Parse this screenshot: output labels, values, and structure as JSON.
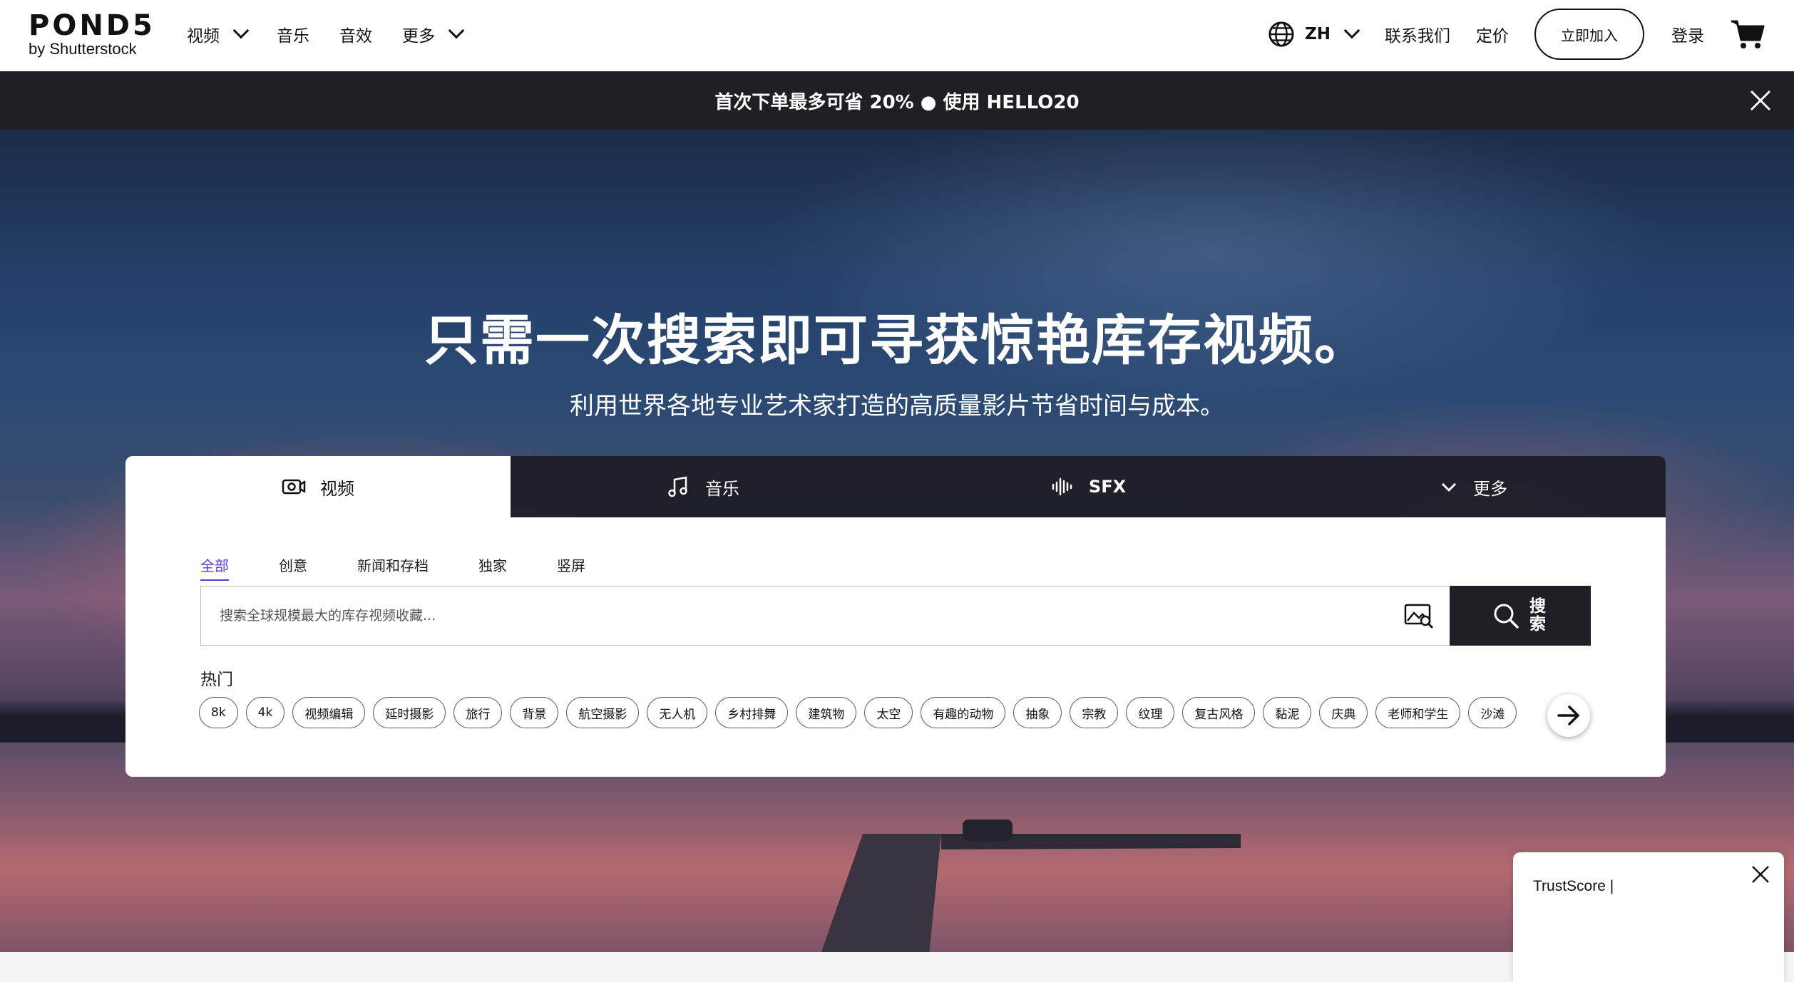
{
  "brand": {
    "name": "POND5",
    "tagline": "by Shutterstock"
  },
  "nav": {
    "items": [
      {
        "label": "视频",
        "has_dropdown": true
      },
      {
        "label": "音乐",
        "has_dropdown": false
      },
      {
        "label": "音效",
        "has_dropdown": false
      },
      {
        "label": "更多",
        "has_dropdown": true
      }
    ],
    "language": "ZH",
    "contact": "联系我们",
    "pricing": "定价",
    "join": "立即加入",
    "login": "登录"
  },
  "promo": {
    "text": "首次下单最多可省 20% ● 使用 HELLO20"
  },
  "hero": {
    "title": "只需一次搜索即可寻获惊艳库存视频。",
    "subtitle": "利用世界各地专业艺术家打造的高质量影片节省时间与成本。"
  },
  "search": {
    "tabs": [
      {
        "label": "视频",
        "icon": "video-camera-icon",
        "active": true
      },
      {
        "label": "音乐",
        "icon": "music-note-icon",
        "active": false
      },
      {
        "label": "SFX",
        "icon": "sound-wave-icon",
        "active": false
      },
      {
        "label": "更多",
        "icon": "chevron-down-icon",
        "active": false
      }
    ],
    "subtabs": [
      "全部",
      "创意",
      "新闻和存档",
      "独家",
      "竖屏"
    ],
    "active_subtab": "全部",
    "placeholder": "搜索全球规模最大的库存视频收藏...",
    "button_label": "搜索",
    "popular_label": "热门",
    "popular": [
      "8k",
      "4k",
      "视频编辑",
      "延时摄影",
      "旅行",
      "背景",
      "航空摄影",
      "无人机",
      "乡村排舞",
      "建筑物",
      "太空",
      "有趣的动物",
      "抽象",
      "宗教",
      "纹理",
      "复古风格",
      "黏泥",
      "庆典",
      "老师和学生",
      "沙滩"
    ]
  },
  "trustscore": {
    "label": "TrustScore |"
  },
  "colors": {
    "promo_bg": "#1f1f25",
    "accent": "#5a3fd0",
    "dark_button": "#1e1e24"
  }
}
